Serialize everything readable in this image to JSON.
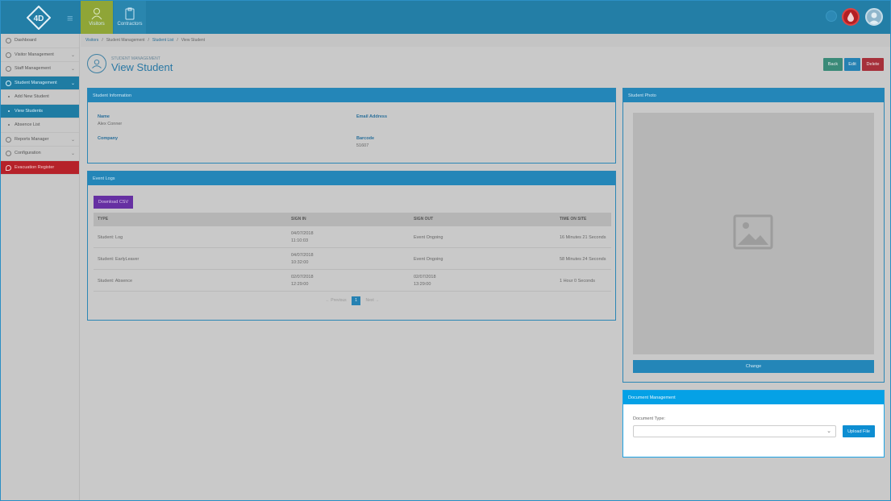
{
  "topbar": {
    "tabs": [
      {
        "label": "Visitors",
        "icon": "person-icon"
      },
      {
        "label": "Contractors",
        "icon": "clipboard-icon"
      }
    ]
  },
  "sidebar": {
    "items": [
      {
        "label": "Dashboard",
        "icon": "dashboard-icon"
      },
      {
        "label": "Visitor Management",
        "icon": "person-icon"
      },
      {
        "label": "Staff Management",
        "icon": "car-icon"
      },
      {
        "label": "Student Management",
        "icon": "person-icon"
      },
      {
        "label": "Add New Student"
      },
      {
        "label": "View Students"
      },
      {
        "label": "Absence List"
      },
      {
        "label": "Reports Manager",
        "icon": "reports-icon"
      },
      {
        "label": "Configuration",
        "icon": "gear-icon"
      },
      {
        "label": "Evacuation Register",
        "icon": "fire-icon"
      }
    ]
  },
  "breadcrumb": {
    "items": [
      "Visitors",
      "Student Management",
      "Student List",
      "View Student"
    ],
    "separator": "/"
  },
  "header": {
    "subtitle": "STUDENT MANAGEMENT",
    "title": "View Student",
    "back_label": "Back",
    "edit_label": "Edit",
    "delete_label": "Delete"
  },
  "student_info": {
    "heading": "Student Information",
    "name_label": "Name",
    "name_value": "Alex Conner",
    "email_label": "Email Address",
    "email_value": "",
    "company_label": "Company",
    "company_value": "",
    "barcode_label": "Barcode",
    "barcode_value": "51607"
  },
  "event_logs": {
    "heading": "Event Logs",
    "download_label": "Download CSV",
    "columns": [
      "TYPE",
      "SIGN IN",
      "SIGN OUT",
      "TIME ON SITE"
    ],
    "rows": [
      {
        "type": "Student: Log",
        "sign_in_date": "04/07/2018",
        "sign_in_time": "11:10:03",
        "sign_out_date": "Event Ongoing",
        "sign_out_time": "",
        "time_on_site": "16 Minutes 21 Seconds"
      },
      {
        "type": "Student: EarlyLeaver",
        "sign_in_date": "04/07/2018",
        "sign_in_time": "10:32:00",
        "sign_out_date": "Event Ongoing",
        "sign_out_time": "",
        "time_on_site": "58 Minutes 24 Seconds"
      },
      {
        "type": "Student: Absence",
        "sign_in_date": "02/07/2018",
        "sign_in_time": "12:29:00",
        "sign_out_date": "02/07/2018",
        "sign_out_time": "13:29:00",
        "time_on_site": "1 Hour 0 Seconds"
      }
    ],
    "pager": {
      "previous": "← Previous",
      "current": "1",
      "next": "Next →"
    }
  },
  "photo": {
    "heading": "Student Photo",
    "change_label": "Change",
    "placeholder_icon": "image-icon"
  },
  "documents": {
    "heading": "Document Management",
    "type_label": "Document Type:",
    "selected": "",
    "upload_label": "Upload File"
  }
}
